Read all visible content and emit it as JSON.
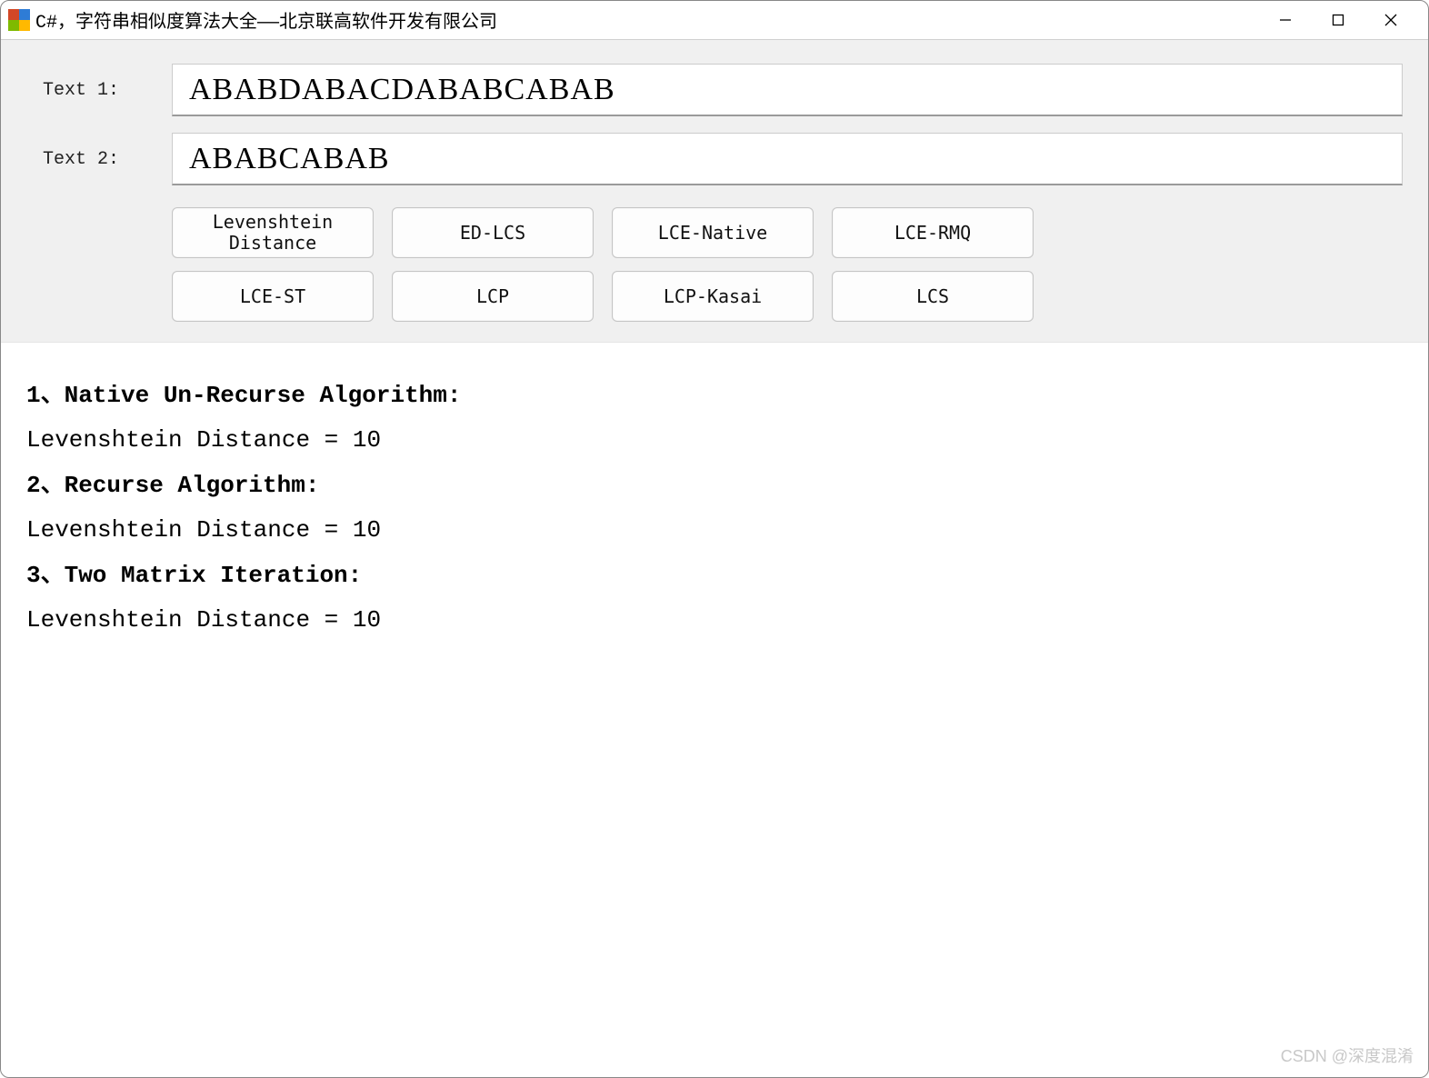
{
  "window": {
    "title": "C#，字符串相似度算法大全——北京联高软件开发有限公司"
  },
  "inputs": {
    "label1": "Text 1:",
    "value1": "ABABDABACDABABCABAB",
    "label2": "Text 2:",
    "value2": "ABABCABAB"
  },
  "buttons": {
    "row1": [
      "Levenshtein\nDistance",
      "ED-LCS",
      "LCE-Native",
      "LCE-RMQ"
    ],
    "row2": [
      "LCE-ST",
      "LCP",
      "LCP-Kasai",
      "LCS"
    ]
  },
  "output": {
    "h1": "1、Native Un-Recurse Algorithm:",
    "r1": "Levenshtein Distance = 10",
    "h2": "2、Recurse Algorithm:",
    "r2": "Levenshtein Distance = 10",
    "h3": "3、Two Matrix Iteration:",
    "r3": "Levenshtein Distance = 10"
  },
  "watermark": "CSDN @深度混淆"
}
